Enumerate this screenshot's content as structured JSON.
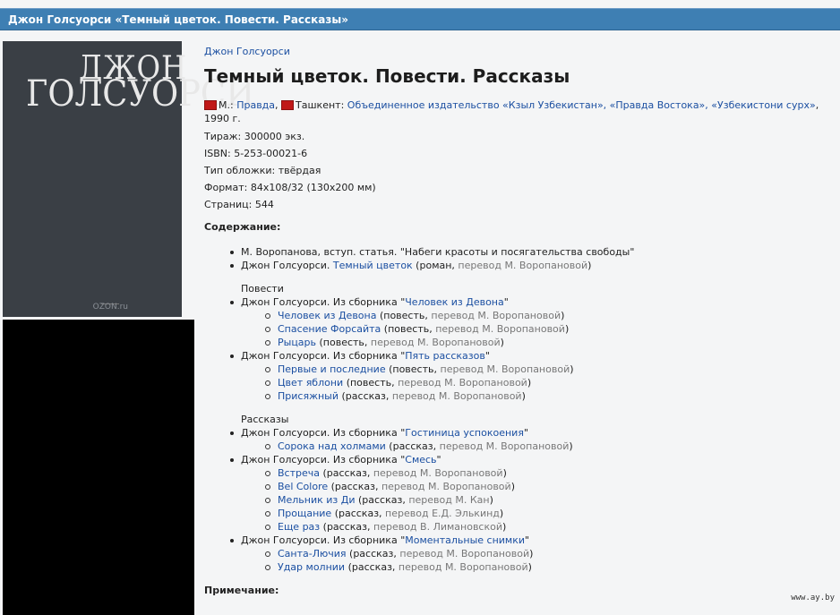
{
  "header": {
    "title": "Джон Голсуорси «Темный цветок. Повести. Рассказы»"
  },
  "cover": {
    "line1": "ДЖОН",
    "line2": "ГОЛСУОРСИ",
    "ozon": "OZON.ru"
  },
  "book": {
    "author_link": "Джон Голсуорси",
    "title": "Темный цветок. Повести. Рассказы",
    "city1": "М.:",
    "pub1": "Правда",
    "city2": "Ташкент:",
    "pub2": "Объединенное издательство «Кзыл Узбекистан», «Правда Востока», «Узбекистони сурх»",
    "year": "1990 г.",
    "tirazh": "Тираж: 300000 экз.",
    "isbn": "ISBN: 5-253-00021-6",
    "cover_type": "Тип обложки: твёрдая",
    "format": "Формат: 84x108/32 (130x200 мм)",
    "pages": "Страниц: 544"
  },
  "contents": {
    "heading": "Содержание:",
    "top_items": [
      {
        "text": "М. Воропанова, вступ. статья. \"Набеги красоты и посягательства свободы\""
      },
      {
        "prefix": "Джон Голсуорси. ",
        "link": "Темный цветок",
        "mid": " (роман, ",
        "trans": "перевод М. Воропановой",
        "end": ")"
      }
    ],
    "group1": "Повести",
    "group1_sub": [
      {
        "prefix": "Джон Голсуорси. Из сборника \"",
        "link": "Человек из Девона",
        "end": "\"",
        "items": [
          {
            "link": "Человек из Девона",
            "type": " (повесть, ",
            "trans": "перевод М. Воропановой",
            "end": ")"
          },
          {
            "link": "Спасение Форсайта",
            "type": " (повесть, ",
            "trans": "перевод М. Воропановой",
            "end": ")"
          },
          {
            "link": "Рыцарь",
            "type": " (повесть, ",
            "trans": "перевод М. Воропановой",
            "end": ")"
          }
        ]
      },
      {
        "prefix": "Джон Голсуорси. Из сборника \"",
        "link": "Пять рассказов",
        "end": "\"",
        "items": [
          {
            "link": "Первые и последние",
            "type": " (повесть, ",
            "trans": "перевод М. Воропановой",
            "end": ")"
          },
          {
            "link": "Цвет яблони",
            "type": " (повесть, ",
            "trans": "перевод М. Воропановой",
            "end": ")"
          },
          {
            "link": "Присяжный",
            "type": " (рассказ, ",
            "trans": "перевод М. Воропановой",
            "end": ")"
          }
        ]
      }
    ],
    "group2": "Рассказы",
    "group2_sub": [
      {
        "prefix": "Джон Голсуорси. Из сборника \"",
        "link": "Гостиница успокоения",
        "end": "\"",
        "items": [
          {
            "link": "Сорока над холмами",
            "type": " (рассказ, ",
            "trans": "перевод М. Воропановой",
            "end": ")"
          }
        ]
      },
      {
        "prefix": "Джон Голсуорси. Из сборника \"",
        "link": "Смесь",
        "end": "\"",
        "items": [
          {
            "link": "Встреча",
            "type": " (рассказ, ",
            "trans": "перевод М. Воропановой",
            "end": ")"
          },
          {
            "link": "Bel Colore",
            "type": " (рассказ, ",
            "trans": "перевод М. Воропановой",
            "end": ")"
          },
          {
            "link": "Мельник из Ди",
            "type": " (рассказ, ",
            "trans": "перевод М. Кан",
            "end": ")"
          },
          {
            "link": "Прощание",
            "type": " (рассказ, ",
            "trans": "перевод Е.Д. Элькинд",
            "end": ")"
          },
          {
            "link": "Еще раз",
            "type": " (рассказ, ",
            "trans": "перевод В. Лимановской",
            "end": ")"
          }
        ]
      },
      {
        "prefix": "Джон Голсуорси. Из сборника \"",
        "link": "Моментальные снимки",
        "end": "\"",
        "items": [
          {
            "link": "Санта-Лючия",
            "type": " (рассказ, ",
            "trans": "перевод М. Воропановой",
            "end": ")"
          },
          {
            "link": "Удар молнии",
            "type": " (рассказ, ",
            "trans": "перевод М. Воропановой",
            "end": ")"
          }
        ]
      }
    ]
  },
  "note": {
    "heading": "Примечание:"
  },
  "watermark": "www.ay.by",
  "colors": {
    "header_bg": "#3e7fb3",
    "link": "#1b4fa1",
    "flag": "#c01818"
  }
}
